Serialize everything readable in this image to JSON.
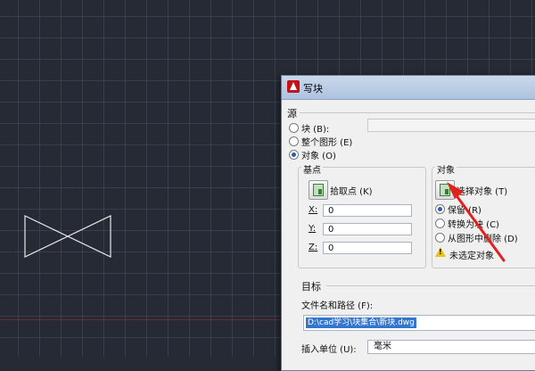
{
  "dialog": {
    "title": "写块",
    "source": {
      "heading": "源",
      "block_label": "块 (B):",
      "block_value": "",
      "whole_drawing_label": "整个图形 (E)",
      "objects_label": "对象 (O)",
      "selected": "objects"
    },
    "base_point": {
      "heading": "基点",
      "pick_label": "拾取点 (K)",
      "x_label": "X:",
      "y_label": "Y:",
      "z_label": "Z:",
      "x_value": "0",
      "y_value": "0",
      "z_value": "0"
    },
    "objects": {
      "heading": "对象",
      "select_label": "选择对象 (T)",
      "retain_label": "保留 (R)",
      "convert_label": "转换为块 (C)",
      "delete_label": "从图形中删除 (D)",
      "selected": "retain",
      "warning": "未选定对象"
    },
    "destination": {
      "heading": "目标",
      "path_label": "文件名和路径 (F):",
      "path_value": "D:\\cad学习\\块集合\\新块.dwg",
      "units_label": "插入单位 (U):",
      "units_value": "毫米"
    }
  },
  "colors": {
    "canvas": "#252a35",
    "annotation_arrow": "#e0211f"
  }
}
